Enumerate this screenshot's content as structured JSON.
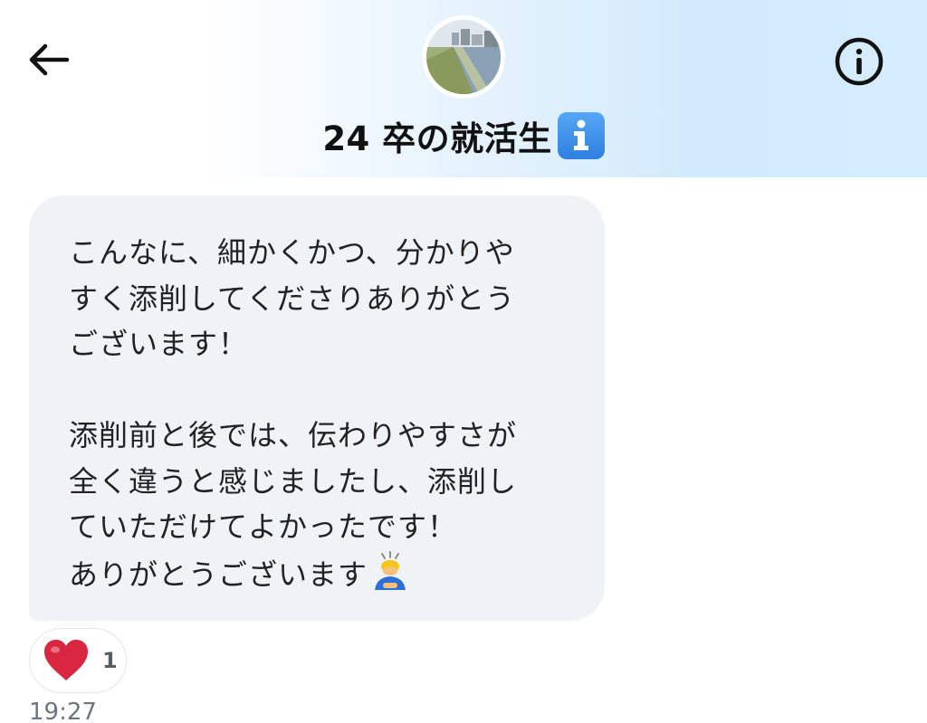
{
  "header": {
    "title": "24 卒の就活生",
    "back_icon": "arrow-left-icon",
    "info_icon": "info-circle-icon",
    "title_badge_icon": "information-emoji-icon"
  },
  "message": {
    "lines": [
      "こんなに、細かくかつ、分かりや",
      "すく添削してくださりありがとう",
      "ございます！",
      "",
      "添削前と後では、伝わりやすさが",
      "全く違うと感じましたし、添削し",
      "ていただけてよかったです！",
      "ありがとうございます"
    ],
    "trailing_emoji": "person-bowing-emoji",
    "bubble_color": "#eff3f5"
  },
  "reaction": {
    "emoji": "red-heart-emoji",
    "count": "1"
  },
  "timestamp": "19:27",
  "colors": {
    "header_gradient_end": "#d4ecfd",
    "badge_blue": "#2f7fe0",
    "heart_red": "#e0245e"
  }
}
